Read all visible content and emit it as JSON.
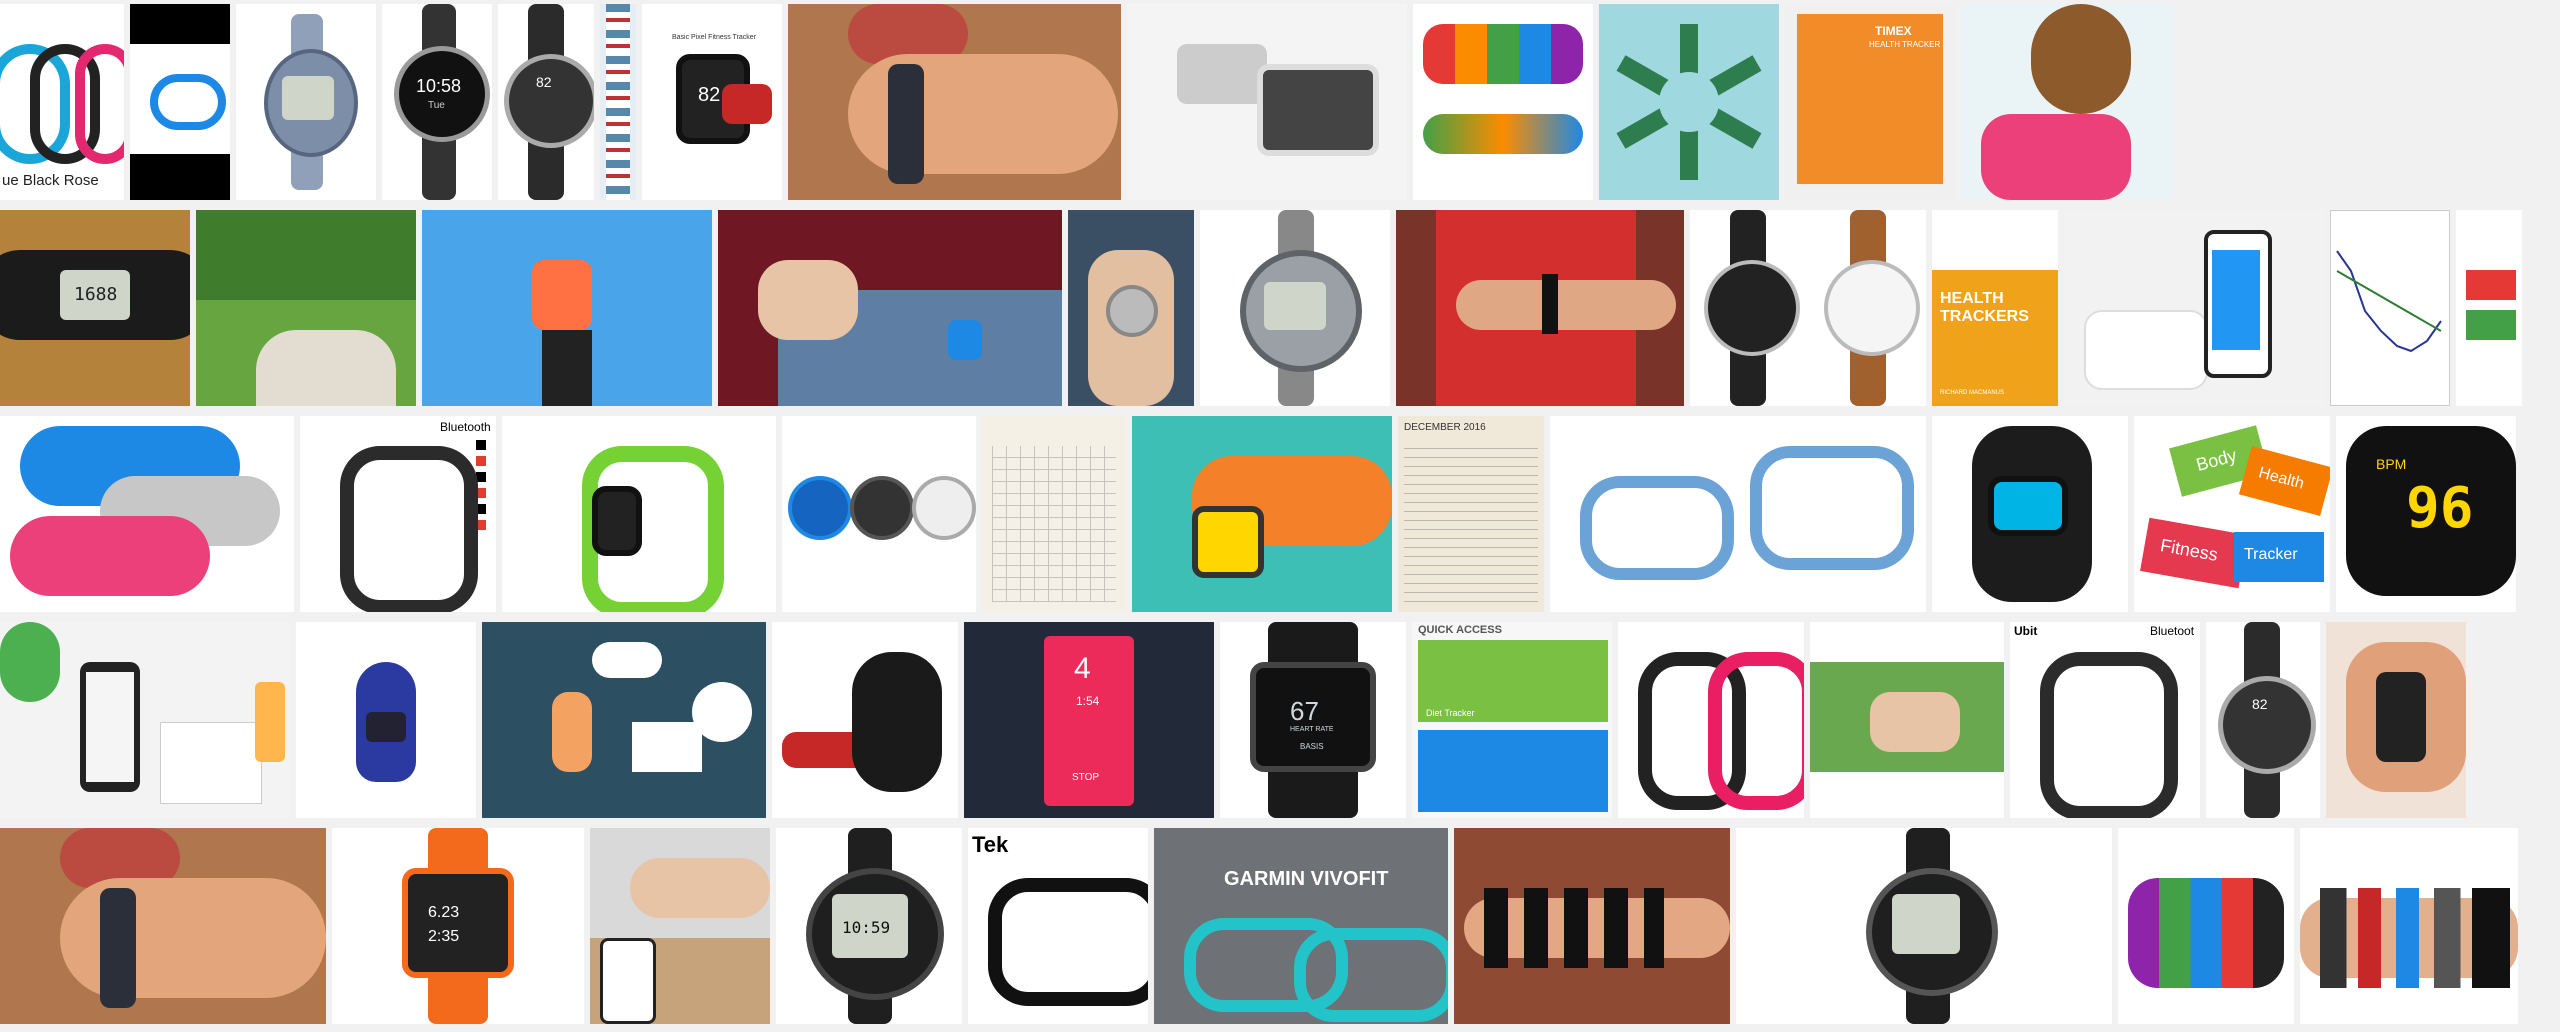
{
  "labels": {
    "colors_caption": "ue    Black    Rose",
    "watch_time_1": "10:58",
    "watch_day_1": "Tue",
    "watch_82": "82",
    "box_title": "Basic Pixel Fitness Tracker",
    "box_82": "82",
    "timex_brand": "TIMEX",
    "timex_sub": "HEALTH TRACKER",
    "pedometer_val": "1688",
    "health_book_title": "HEALTH TRACKERS",
    "health_book_author": "RICHARD MACMANUS",
    "bluetooth_1": "Bluetooth",
    "body_tag": "Body",
    "health_tag": "Health",
    "fitness_tag": "Fitness",
    "tracker_tag": "Tracker",
    "bpm_display": "BPM",
    "bpm_num": "96",
    "quick_access": "QUICK ACCESS",
    "diet_tracker": "Diet Tracker",
    "phone_4": "4",
    "phone_time": "1:54",
    "phone_stop": "STOP",
    "basis_67": "67",
    "basis_sub": "HEART RATE",
    "basis_brand": "BASIS",
    "bluetooth_2": "Bluetoot",
    "ubit": "Ubit",
    "watch_82_b": "82",
    "tek": "Tek",
    "garmin": "GARMIN VIVOFIT",
    "orange_val_1": "6.23",
    "orange_val_2": "2:35",
    "black_watch_val": "10:59",
    "december": "DECEMBER 2016"
  },
  "colors": {
    "background": "#f1f1f1",
    "green_tile": "#7ac143",
    "blue_tile": "#1e88e5",
    "star_green": "#2e7d4f",
    "teal_bg": "#9fd8df"
  }
}
